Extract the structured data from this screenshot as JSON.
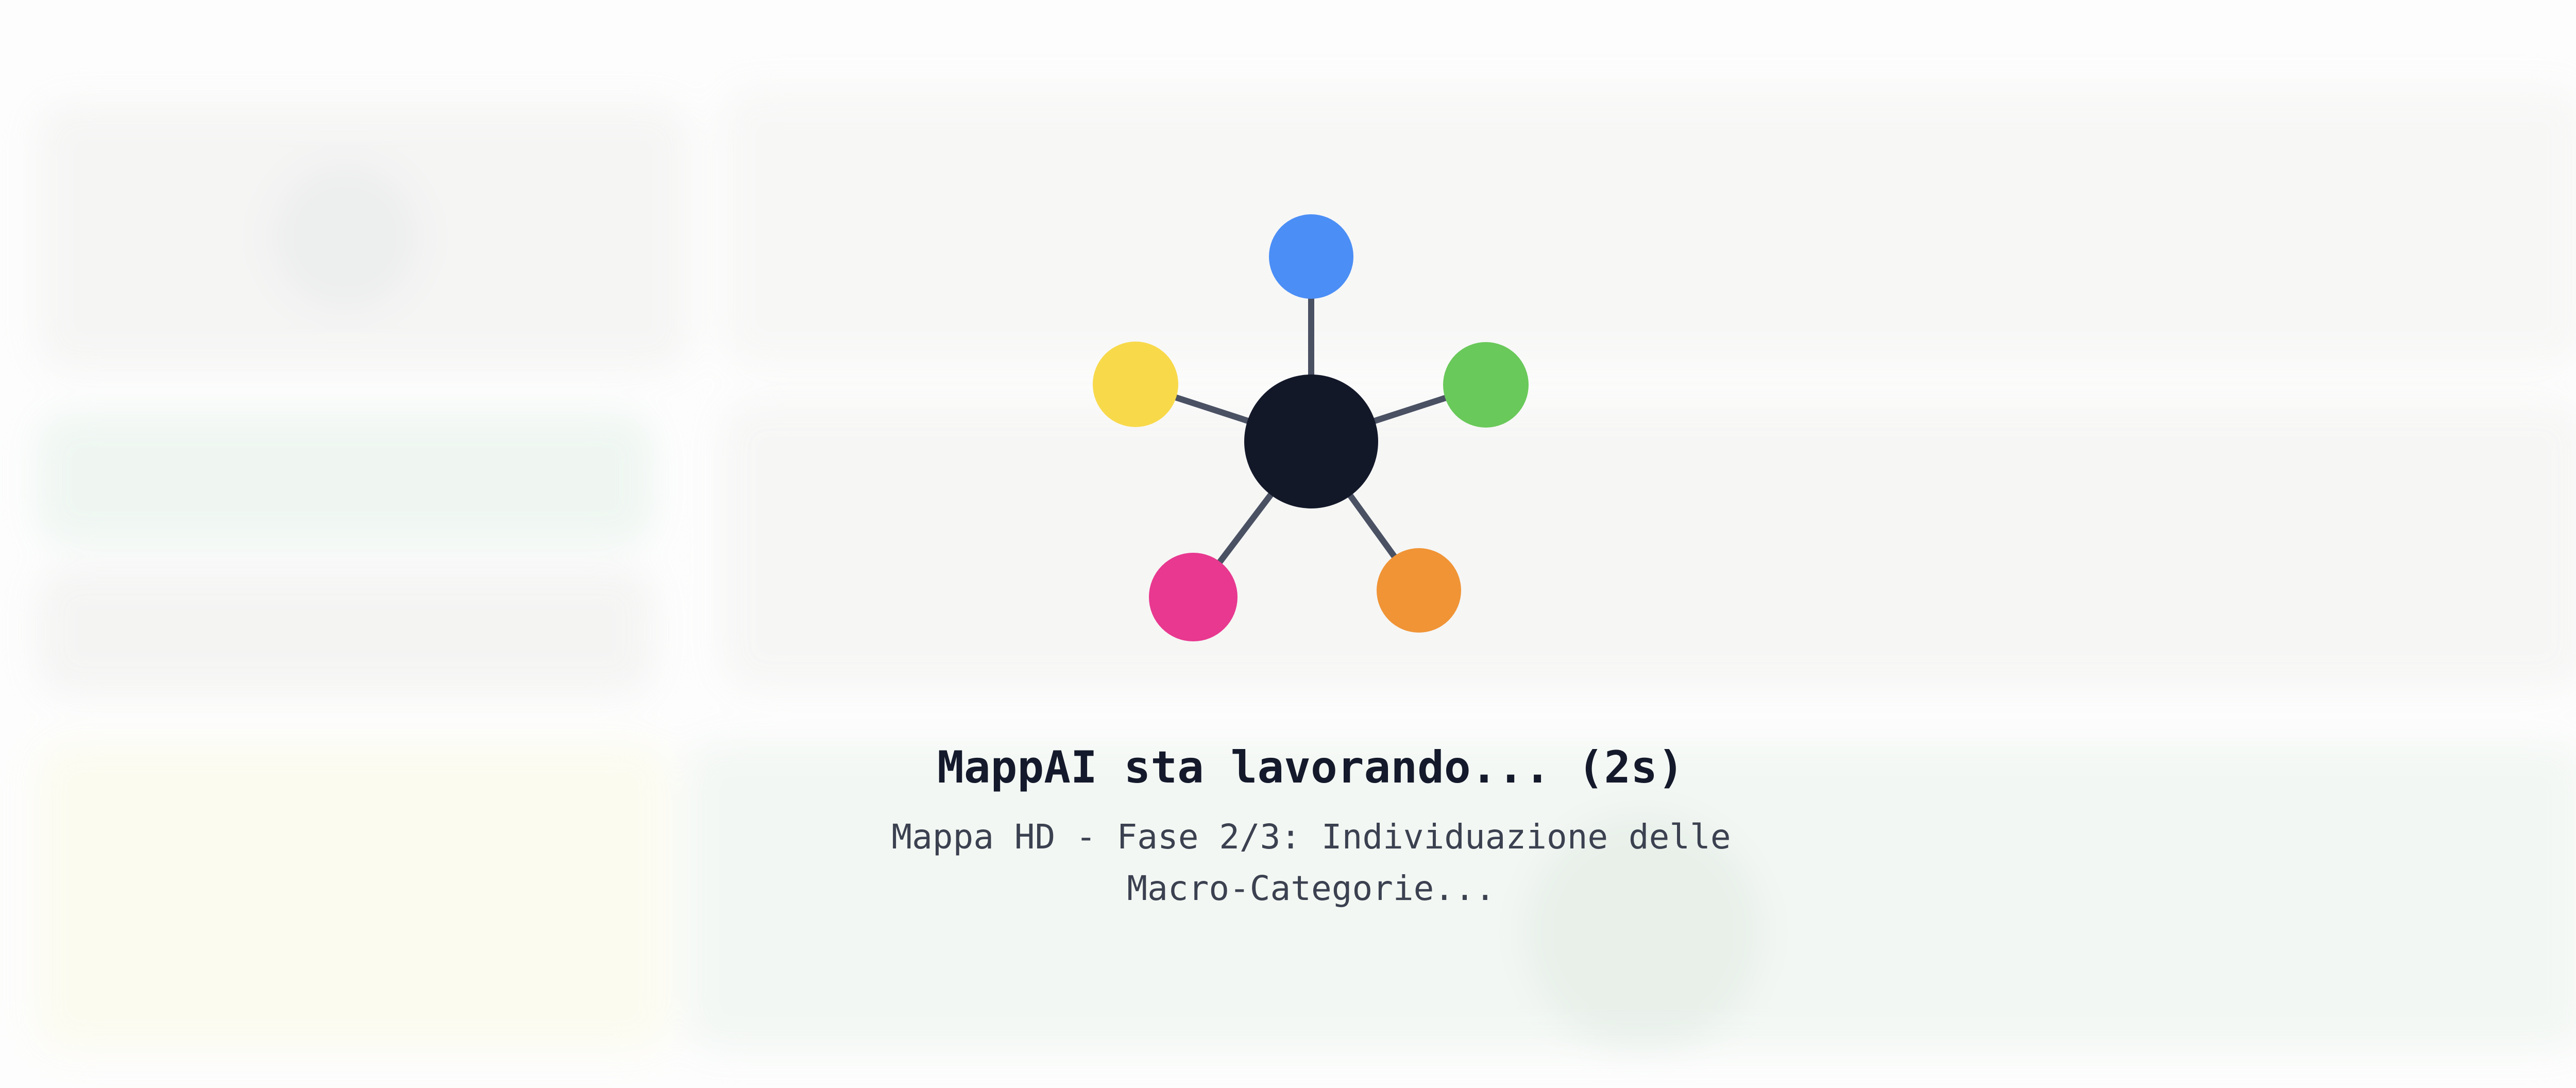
{
  "loader": {
    "title": "MappAI sta lavorando... (2s)",
    "subtitle": "Mappa HD - Fase 2/3: Individuazione delle Macro-Categorie..."
  },
  "graph_icon": {
    "center_color": "#131829",
    "edge_color": "#4a5163",
    "nodes": [
      {
        "name": "blue-node",
        "color": "#4b8ef6"
      },
      {
        "name": "green-node",
        "color": "#69c95a"
      },
      {
        "name": "orange-node",
        "color": "#f09436"
      },
      {
        "name": "pink-node",
        "color": "#e8388f"
      },
      {
        "name": "yellow-node",
        "color": "#f8d94a"
      }
    ]
  }
}
